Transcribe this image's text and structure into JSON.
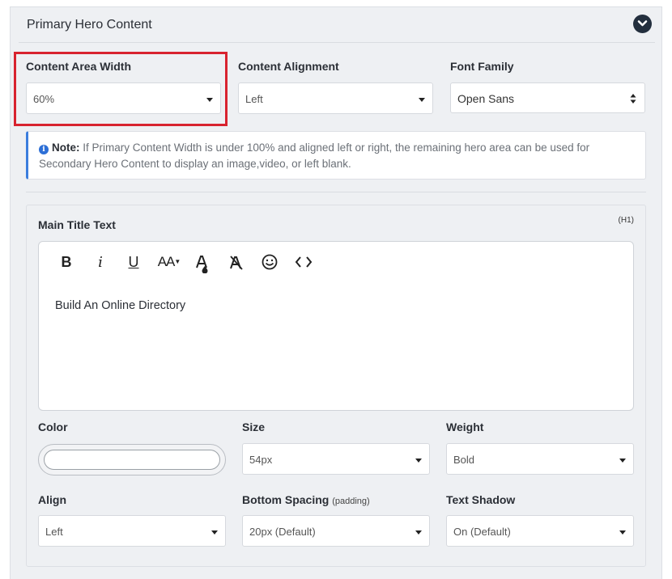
{
  "section": {
    "title": "Primary Hero Content",
    "collapse_icon": "chevron-down-icon"
  },
  "fields": {
    "content_area_width": {
      "label": "Content Area Width",
      "value": "60%"
    },
    "content_alignment": {
      "label": "Content Alignment",
      "value": "Left"
    },
    "font_family": {
      "label": "Font Family",
      "value": "Open Sans"
    }
  },
  "note": {
    "prefix": "Note:",
    "text": "If Primary Content Width is under 100% and aligned left or right, the remaining hero area can be used for Secondary Hero Content to display an image,video, or left blank.",
    "icon": "info-icon"
  },
  "main_title": {
    "label": "Main Title Text",
    "tag": "(H1)",
    "toolbar": [
      "bold",
      "italic",
      "underline",
      "font-size",
      "text-color",
      "clear-format",
      "emoji",
      "code-view"
    ],
    "toolbar_glyphs": {
      "bold": "B",
      "italic": "i",
      "underline": "U",
      "font_size": "AA",
      "code": "<>"
    },
    "content": "Build An Online Directory"
  },
  "style_fields": {
    "color": {
      "label": "Color",
      "value": ""
    },
    "size": {
      "label": "Size",
      "value": "54px"
    },
    "weight": {
      "label": "Weight",
      "value": "Bold"
    },
    "align": {
      "label": "Align",
      "value": "Left"
    },
    "bottom_spacing": {
      "label": "Bottom Spacing",
      "hint": "(padding)",
      "value": "20px (Default)"
    },
    "text_shadow": {
      "label": "Text Shadow",
      "value": "On (Default)"
    }
  },
  "colors": {
    "accent_blue": "#3b7ddd",
    "highlight_red": "#d8232f",
    "dark_button": "#232f3e"
  }
}
